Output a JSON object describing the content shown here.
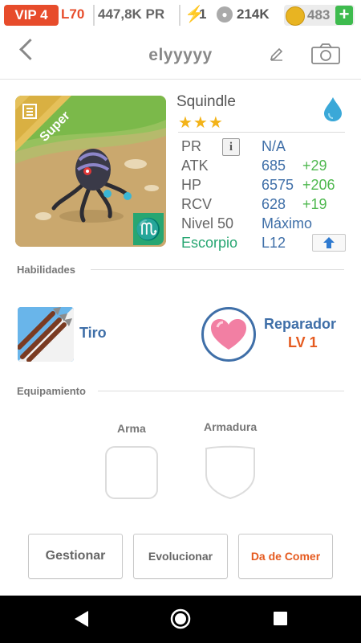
{
  "status": {
    "vip": "VIP 4",
    "level": "L70",
    "power": "447,8K PR",
    "energy": "1",
    "paws": "214K",
    "coins": "483",
    "add": "+"
  },
  "header": {
    "title": "elyyyyy"
  },
  "monster": {
    "name": "Squindle",
    "rarity": "Super",
    "stars": "★★★",
    "element_icon": "water-drop-icon",
    "zodiac_symbol": "♏",
    "stats": [
      {
        "label": "PR",
        "value": "N/A",
        "bonus": ""
      },
      {
        "label": "ATK",
        "value": "685",
        "bonus": "+29"
      },
      {
        "label": "HP",
        "value": "6575",
        "bonus": "+206"
      },
      {
        "label": "RCV",
        "value": "628",
        "bonus": "+19"
      },
      {
        "label": "Nivel 50",
        "value": "Máximo",
        "bonus": ""
      }
    ],
    "zodiac": {
      "label": "Escorpio",
      "value": "L12"
    },
    "info_icon": "i"
  },
  "abilities": {
    "title": "Habilidades",
    "skill1": {
      "name": "Tiro"
    },
    "skill2": {
      "name": "Reparador",
      "level": "LV 1"
    }
  },
  "equipment": {
    "title": "Equipamiento",
    "weapon": "Arma",
    "armor": "Armadura"
  },
  "actions": {
    "manage": "Gestionar",
    "evolve": "Evolucionar",
    "feed": "Da de Comer"
  },
  "colors": {
    "accent_blue": "#3f6fa8",
    "bonus_green": "#4fb84f",
    "zodiac_green": "#27a672",
    "vip_red": "#e74c2b",
    "feed_orange": "#e55a1f"
  }
}
